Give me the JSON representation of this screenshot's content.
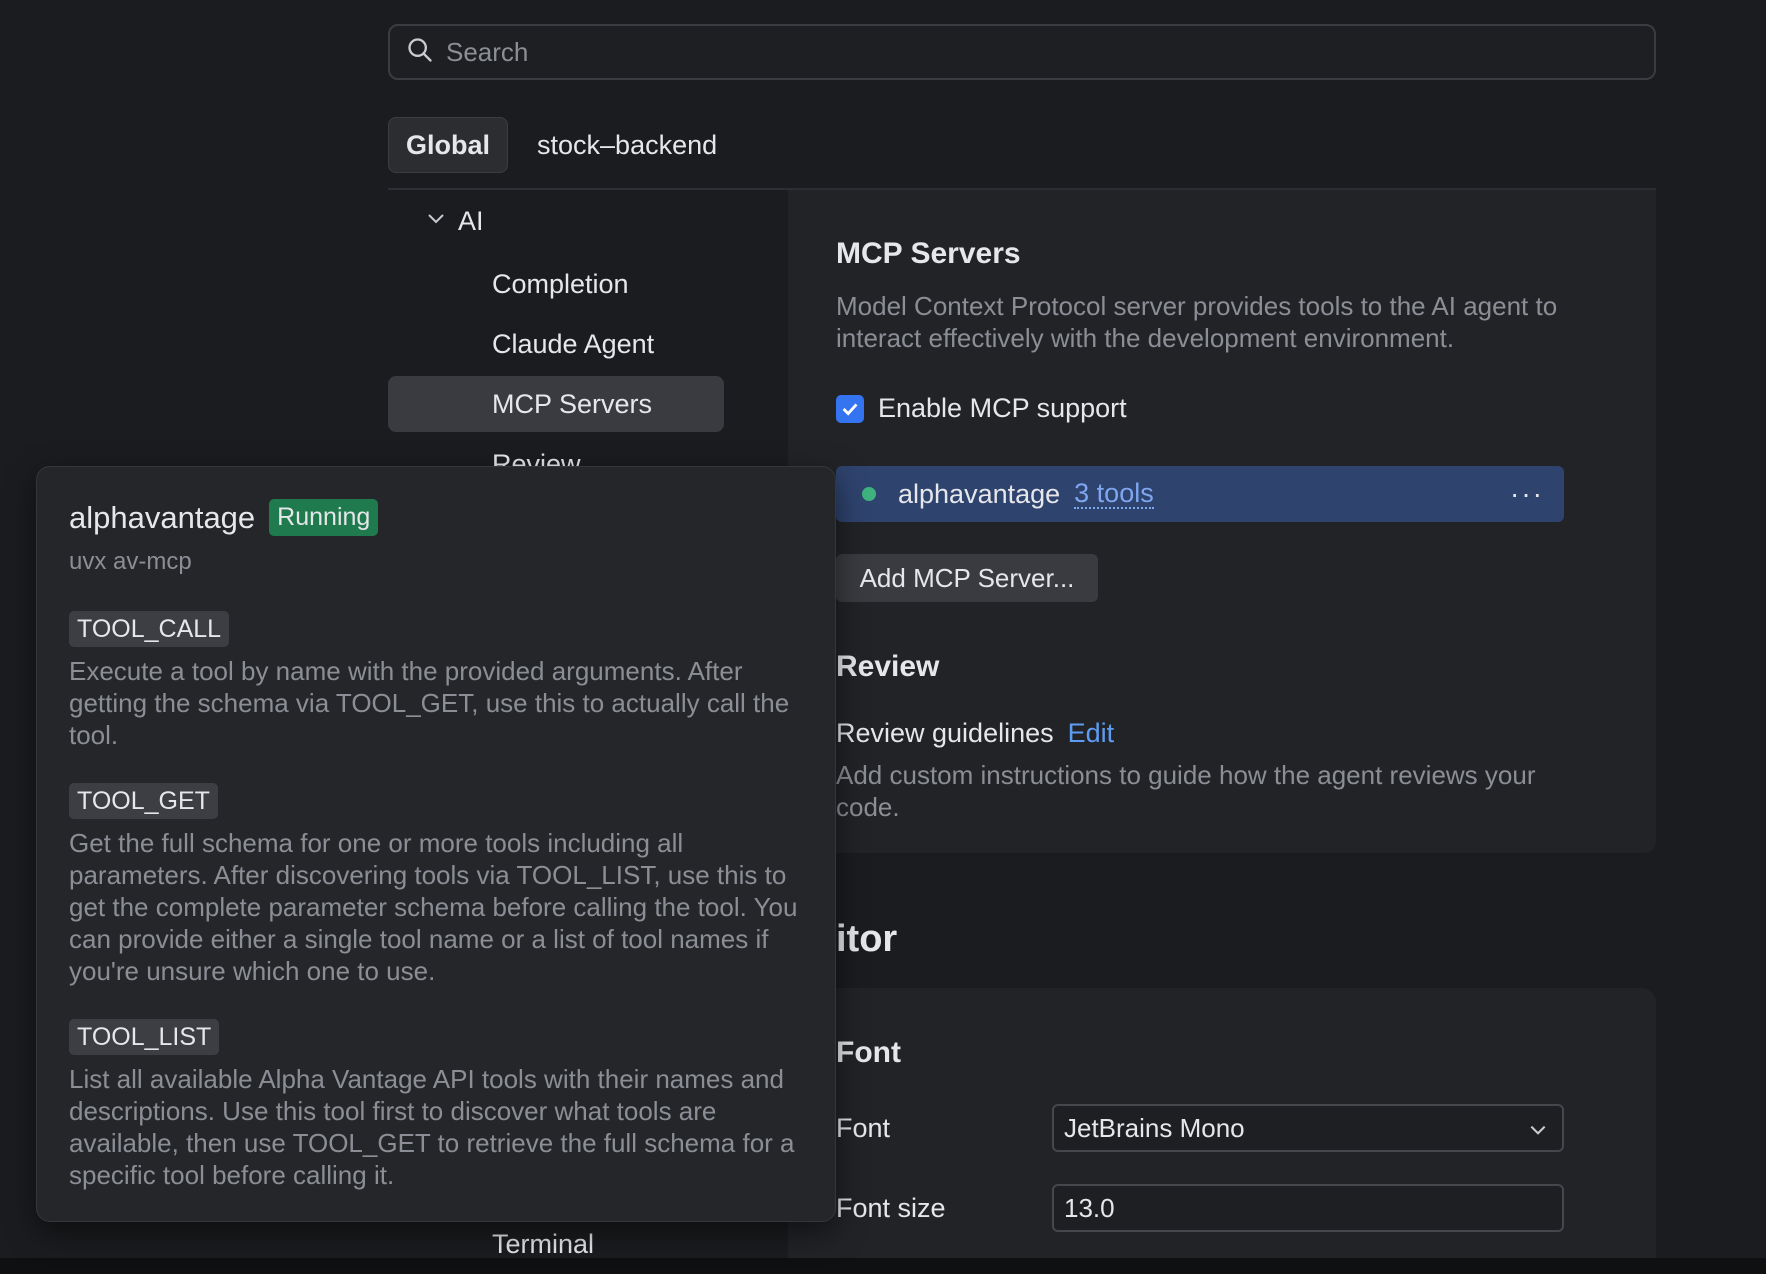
{
  "search": {
    "placeholder": "Search"
  },
  "scope_tabs": [
    {
      "label": "Global"
    },
    {
      "label": "stock–backend"
    }
  ],
  "nav": {
    "group_label": "AI",
    "items": [
      {
        "label": "Completion"
      },
      {
        "label": "Claude Agent"
      },
      {
        "label": "MCP Servers"
      },
      {
        "label": "Review"
      },
      {
        "label": "Terminal"
      }
    ]
  },
  "mcp": {
    "title": "MCP Servers",
    "description": "Model Context Protocol server provides tools to the AI agent to interact effectively with the development environment.",
    "enable_label": "Enable MCP support",
    "enabled": true,
    "server": {
      "name": "alphavantage",
      "tools_label": "3 tools",
      "more": "···"
    },
    "add_button": "Add MCP Server..."
  },
  "review": {
    "title": "Review",
    "guidelines_label": "Review guidelines",
    "edit_link": "Edit",
    "description": "Add custom instructions to guide how the agent reviews your code."
  },
  "editor": {
    "heading": "itor",
    "font_section": "Font",
    "font_label": "Font",
    "font_value": "JetBrains Mono",
    "font_size_label": "Font size",
    "font_size_value": "13.0"
  },
  "popup": {
    "name": "alphavantage",
    "status": "Running",
    "command": "uvx av-mcp",
    "tools": [
      {
        "name": "TOOL_CALL",
        "description": "Execute a tool by name with the provided arguments. After getting the schema via TOOL_GET, use this to actually call the tool."
      },
      {
        "name": "TOOL_GET",
        "description": "Get the full schema for one or more tools including all parameters. After discovering tools via TOOL_LIST, use this to get the complete parameter schema before calling the tool. You can provide either a single tool name or a list of tool names if you're unsure which one to use."
      },
      {
        "name": "TOOL_LIST",
        "description": "List all available Alpha Vantage API tools with their names and descriptions. Use this tool first to discover what tools are available, then use TOOL_GET to retrieve the full schema for a specific tool before calling it."
      }
    ]
  },
  "colors": {
    "background": "#1b1c1f",
    "accent": "#3574f0",
    "server_row": "#2e436e",
    "running_badge": "#1f7a4d",
    "status_dot": "#3fb27f",
    "link": "#5d9cf3"
  }
}
